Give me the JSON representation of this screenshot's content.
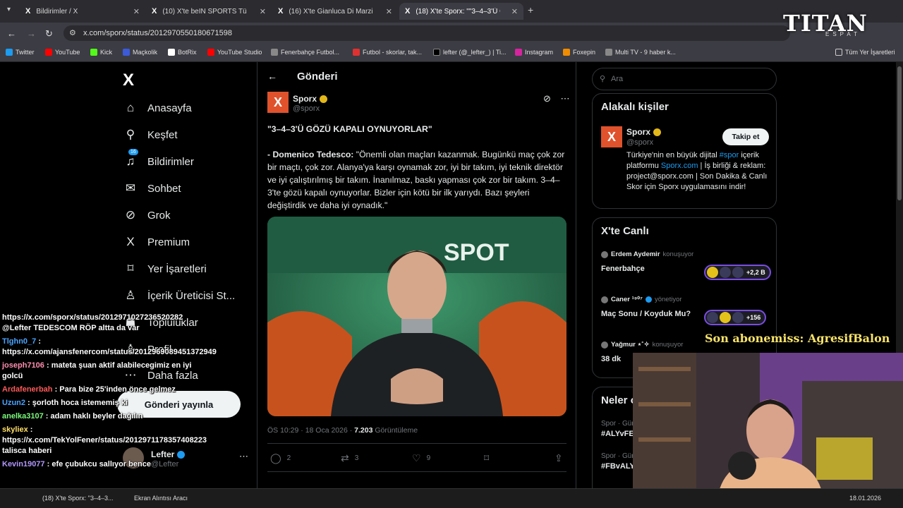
{
  "browser": {
    "tabs": [
      {
        "title": "Bildirimler / X"
      },
      {
        "title": "(10) X'te beIN SPORTS Türkiye:"
      },
      {
        "title": "(16) X'te Gianluca Di Marzio: \"..."
      },
      {
        "title": "(18) X'te Sporx: \"\"3–4–3'Ü GÖZÜ"
      }
    ],
    "url": "x.com/sporx/status/2012970550180671598",
    "bookmarks": [
      {
        "label": "Twitter",
        "color": "#1d9bf0"
      },
      {
        "label": "YouTube",
        "color": "#ff0000"
      },
      {
        "label": "Kick",
        "color": "#53fc18"
      },
      {
        "label": "Maçkolik",
        "color": "#3b5bdb"
      },
      {
        "label": "BotRix",
        "color": "#ffffff"
      },
      {
        "label": "YouTube Studio",
        "color": "#ff0000"
      },
      {
        "label": "Fenerbahçe Futbol...",
        "color": "#888888"
      },
      {
        "label": "Futbol - skorlar, tak...",
        "color": "#e03131"
      },
      {
        "label": "lefter (@_lefter_) | Ti...",
        "color": "#000000"
      },
      {
        "label": "Instagram",
        "color": "#d6249f"
      },
      {
        "label": "Foxepin",
        "color": "#f08c00"
      },
      {
        "label": "Multi TV - 9 haber k...",
        "color": "#888888"
      }
    ],
    "all_bookmarks": "Tüm Yer İşaretleri"
  },
  "sidebar": {
    "items": [
      {
        "label": "Anasayfa",
        "icon": "home-icon"
      },
      {
        "label": "Keşfet",
        "icon": "search-icon"
      },
      {
        "label": "Bildirimler",
        "icon": "bell-icon",
        "badge": "16"
      },
      {
        "label": "Sohbet",
        "icon": "mail-icon"
      },
      {
        "label": "Grok",
        "icon": "grok-icon"
      },
      {
        "label": "Premium",
        "icon": "x-icon"
      },
      {
        "label": "Yer İşaretleri",
        "icon": "bookmark-icon"
      },
      {
        "label": "İçerik Üreticisi St...",
        "icon": "creator-icon"
      },
      {
        "label": "Topluluklar",
        "icon": "people-icon"
      },
      {
        "label": "Profil",
        "icon": "person-icon"
      },
      {
        "label": "Daha fazla",
        "icon": "more-circle-icon"
      }
    ],
    "post_button": "Gönderi yayınla",
    "account": {
      "name": "Lefter",
      "handle": "@Lefter"
    }
  },
  "post": {
    "header": "Gönderi",
    "author": {
      "name": "Sporx",
      "handle": "@sporx"
    },
    "title": "\"3–4–3'Ü GÖZÜ KAPALI OYNUYORLAR\"",
    "speaker": "- Domenico Tedesco:",
    "quote": " \"Önemli olan maçları kazanmak. Bugünkü maç çok zor bir maçtı, çok zor. Alanya'ya karşı oynamak zor, iyi bir takım, iyi teknik direktör ve iyi çalıştırılmış bir takım. İnanılmaz, baskı yapması çok zor bir takım. 3–4–3'te gözü kapalı oynuyorlar. Bizler için kötü bir ilk yarıydı. Bazı şeyleri değiştirdik ve daha iyi oynadık.\"",
    "time": "ÖS 10:29 · 18 Oca 2026 · ",
    "views": "7.203",
    "views_label": " Görüntüleme",
    "replies": "2",
    "reposts": "3",
    "likes": "9"
  },
  "right": {
    "search_placeholder": "Ara",
    "related_title": "Alakalı kişiler",
    "related": {
      "name": "Sporx",
      "handle": "@sporx",
      "follow": "Takip et",
      "bio1": "Türkiye'nin en büyük dijital ",
      "bio_tag": "#spor",
      "bio2": " içerik platformu ",
      "bio_link": "Sporx.com",
      "bio3": " | İş birliği & reklam: project@sporx.com | Son Dakika & Canlı Skor için Sporx uygulamasını indir!"
    },
    "live_title": "X'te Canlı",
    "live": [
      {
        "host": "Erdem Aydemir",
        "role": "konuşuyor",
        "topic": "Fenerbahçe",
        "count": "+2,2 B"
      },
      {
        "host": "Caner ¹⁹⁰⁷",
        "role": "yönetiyor",
        "topic": "Maç Sonu / Koyduk Mu?",
        "count": "+156"
      },
      {
        "host": "Yağmur ⋆˚✧",
        "role": "konuşuyor",
        "topic": "38 dk",
        "count": ""
      }
    ],
    "trends_title": "Neler o",
    "trends": [
      {
        "category": "Spor · Gün",
        "tag": "#ALYvFE"
      },
      {
        "category": "Spor · Gün",
        "tag": "#FBvALY"
      }
    ]
  },
  "stream": {
    "logo": "TITAN",
    "logo_sub": "ESPAT",
    "sub_banner": "Son abonemiss: AgresifBalon",
    "chat": [
      {
        "user": "",
        "color": "#ffffff",
        "text": "https://x.com/sporx/status/2012971027236520282 @Lefter TEDESCOM RÖP altta da var"
      },
      {
        "user": "Tlghn0_7",
        "color": "#4aa3ff",
        "text": " : https://x.com/ajansfenercom/status/2012969089451372949"
      },
      {
        "user": "joseph7106",
        "color": "#ff8fb1",
        "text": " : mateta şuan aktif alabilecegimiz en iyi golcü"
      },
      {
        "user": "Ardafenerbah",
        "color": "#ff5a5a",
        "text": " : Para bize 25'inden önce gelmez"
      },
      {
        "user": "Uzun2",
        "color": "#4aa3ff",
        "text": " : şorloth hoca istememiş ki"
      },
      {
        "user": "anelka3107",
        "color": "#7cfc7c",
        "text": " : adam haklı beyler dağılın"
      },
      {
        "user": "skyliex",
        "color": "#ffe066",
        "text": " : https://x.com/TekYolFener/status/2012971178357408223 talisca haberi"
      },
      {
        "user": "Kevin19077",
        "color": "#b197fc",
        "text": " : efe çubukcu sallıyor bence"
      }
    ],
    "taskbar": [
      "(18) X'te Sporx: \"3–4–3...",
      "Ekran Alıntısı Aracı"
    ],
    "clock": "18.01.2026"
  }
}
